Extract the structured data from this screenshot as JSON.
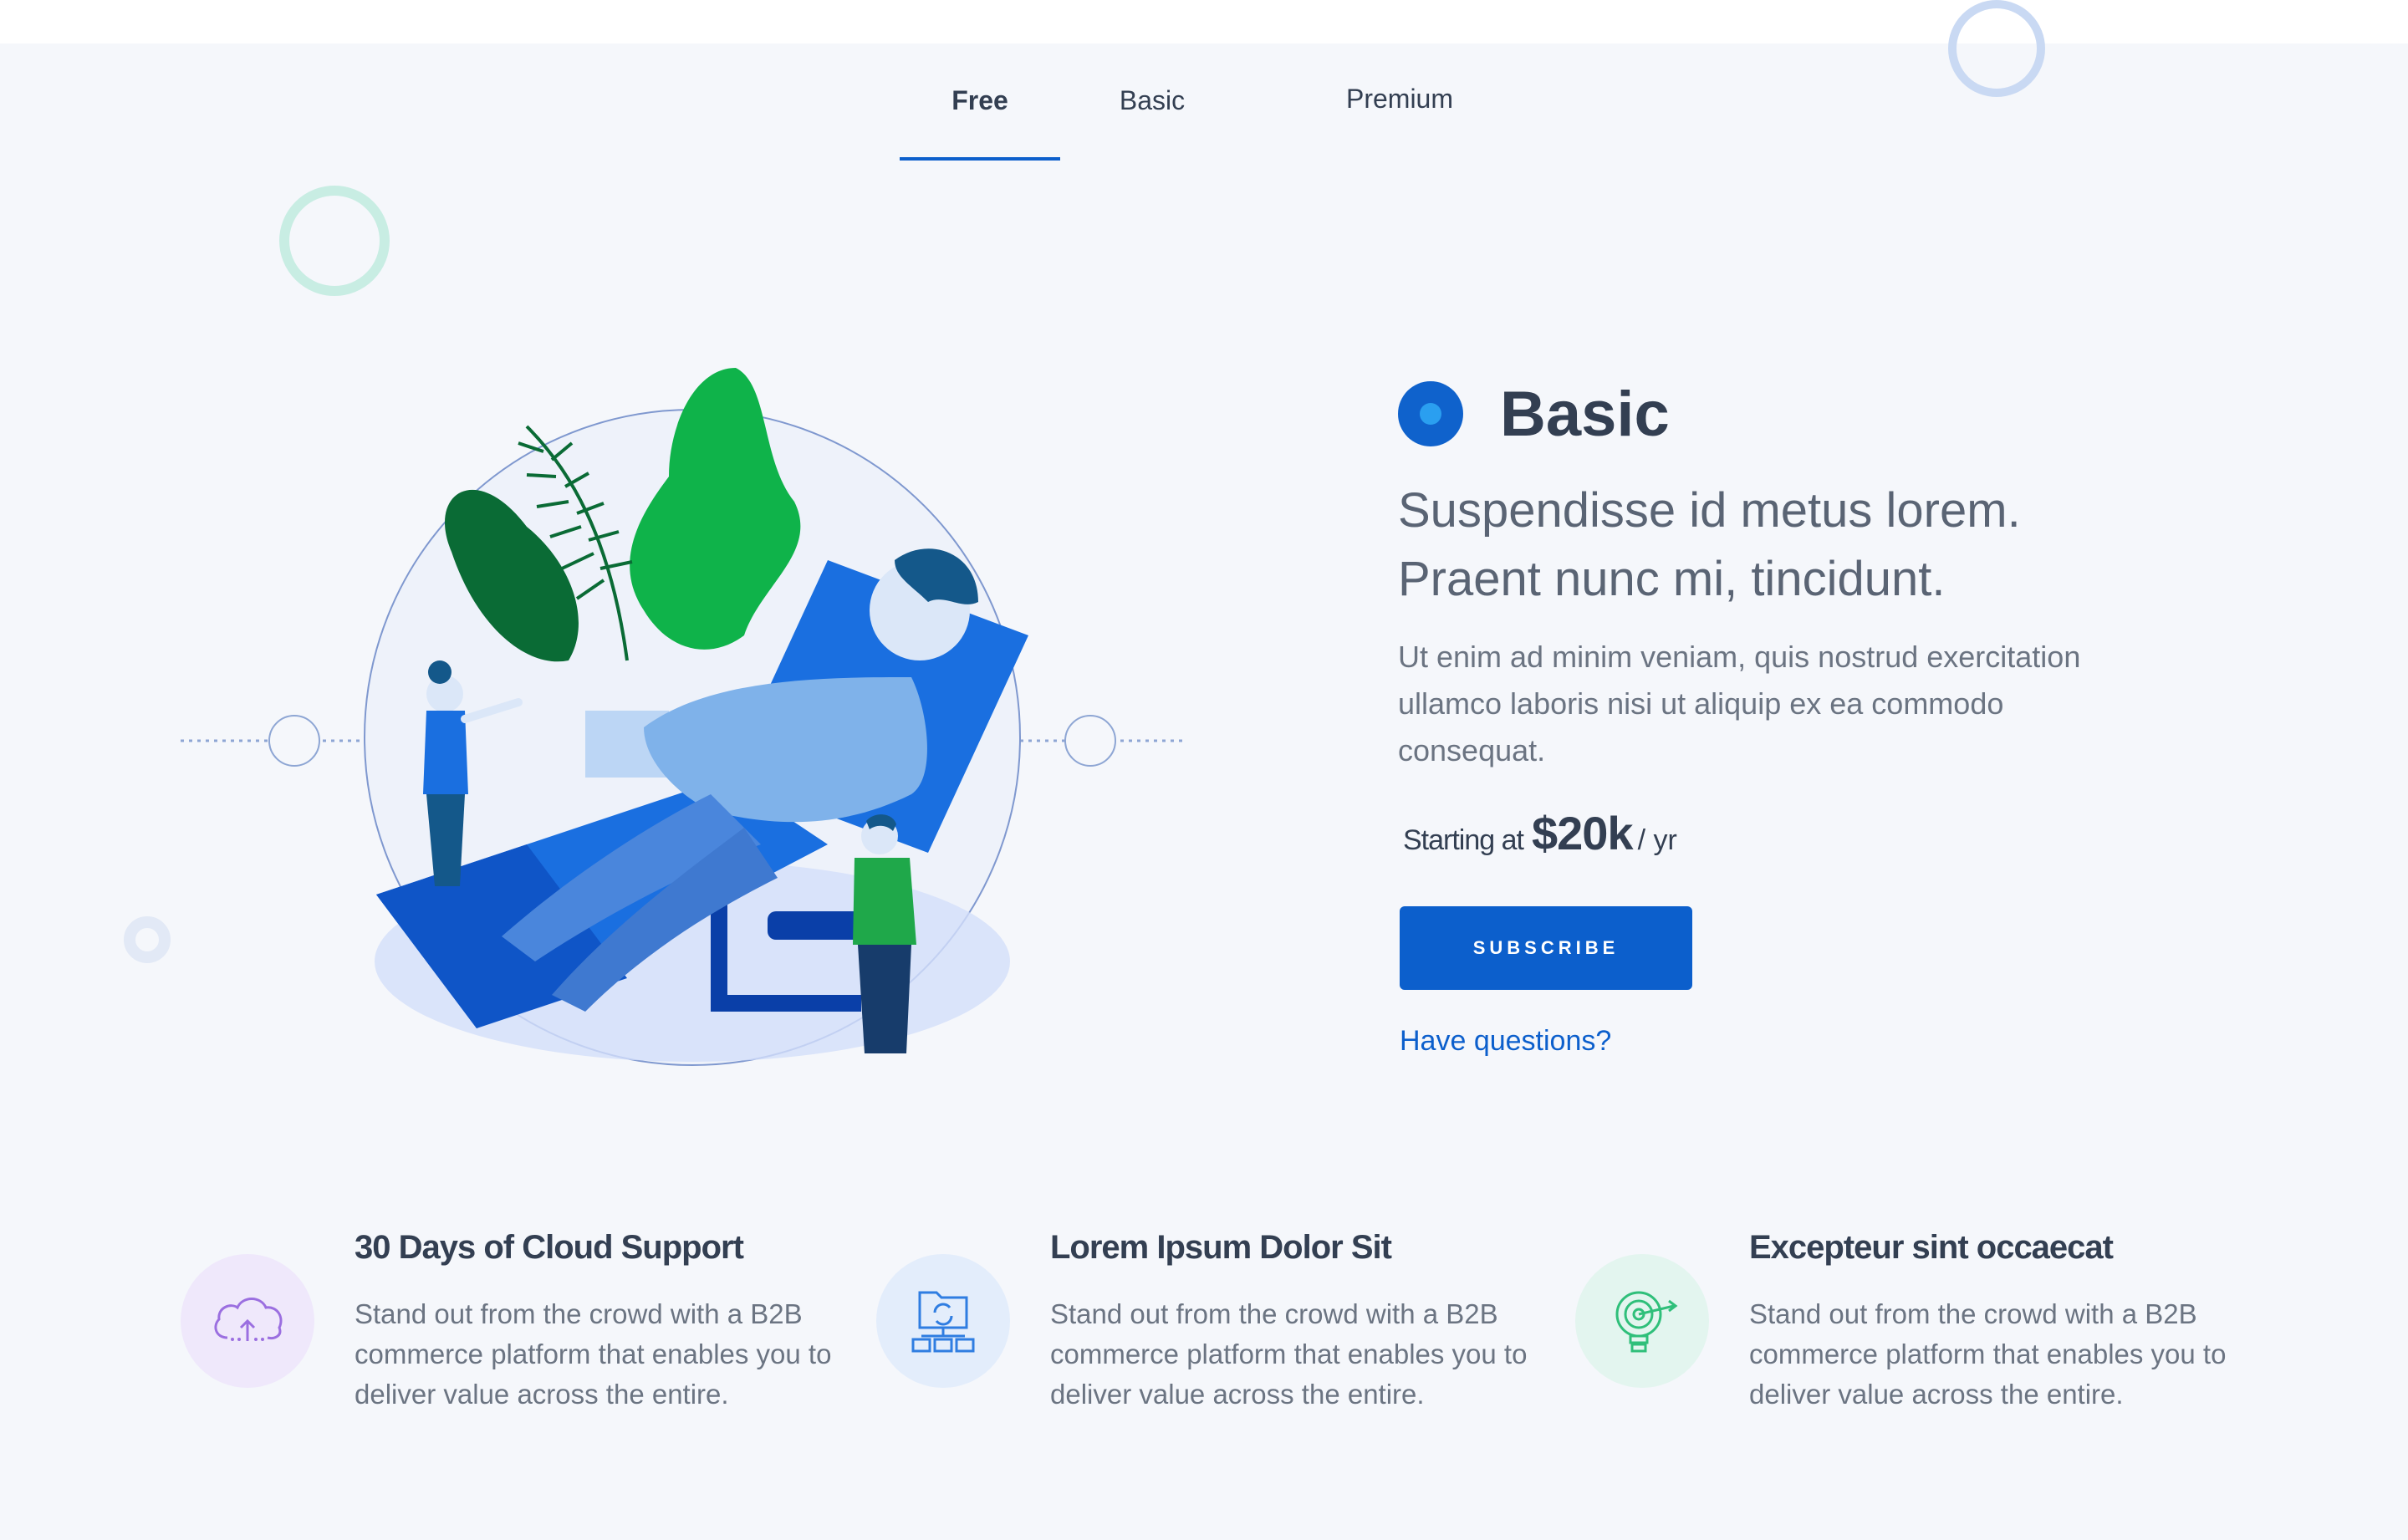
{
  "tabs": [
    {
      "label": "Free",
      "active": true
    },
    {
      "label": "Basic",
      "active": false
    },
    {
      "label": "Premium",
      "active": false
    }
  ],
  "plan": {
    "title": "Basic",
    "headline_line1": "Suspendisse id metus lorem.",
    "headline_line2": "Praent nunc mi, tincidunt.",
    "description": "Ut enim ad minim veniam, quis nostrud exercitation ullamco laboris nisi ut aliquip ex ea commodo consequat.",
    "price_lead": "Starting at",
    "price_amount": "$20k",
    "price_unit": "/ yr",
    "subscribe_label": "SUBSCRIBE",
    "questions_label": "Have questions?"
  },
  "features": [
    {
      "title": "30 Days of Cloud Support",
      "text": "Stand out from the crowd with a B2B commerce platform that enables you to deliver value across the entire.",
      "icon": "cloud-sync-icon"
    },
    {
      "title": "Lorem Ipsum Dolor Sit",
      "text": "Stand out from the crowd with a B2B commerce platform that enables you to deliver value across the entire.",
      "icon": "network-folder-icon"
    },
    {
      "title": "Excepteur sint occaecat",
      "text": "Stand out from the crowd with a B2B commerce platform that enables you to deliver value across the entire.",
      "icon": "lightbulb-target-icon"
    }
  ],
  "colors": {
    "accent": "#0c5fcc",
    "background": "#f5f7fb",
    "text_dark": "#333f52",
    "text_muted": "#6b7482"
  }
}
